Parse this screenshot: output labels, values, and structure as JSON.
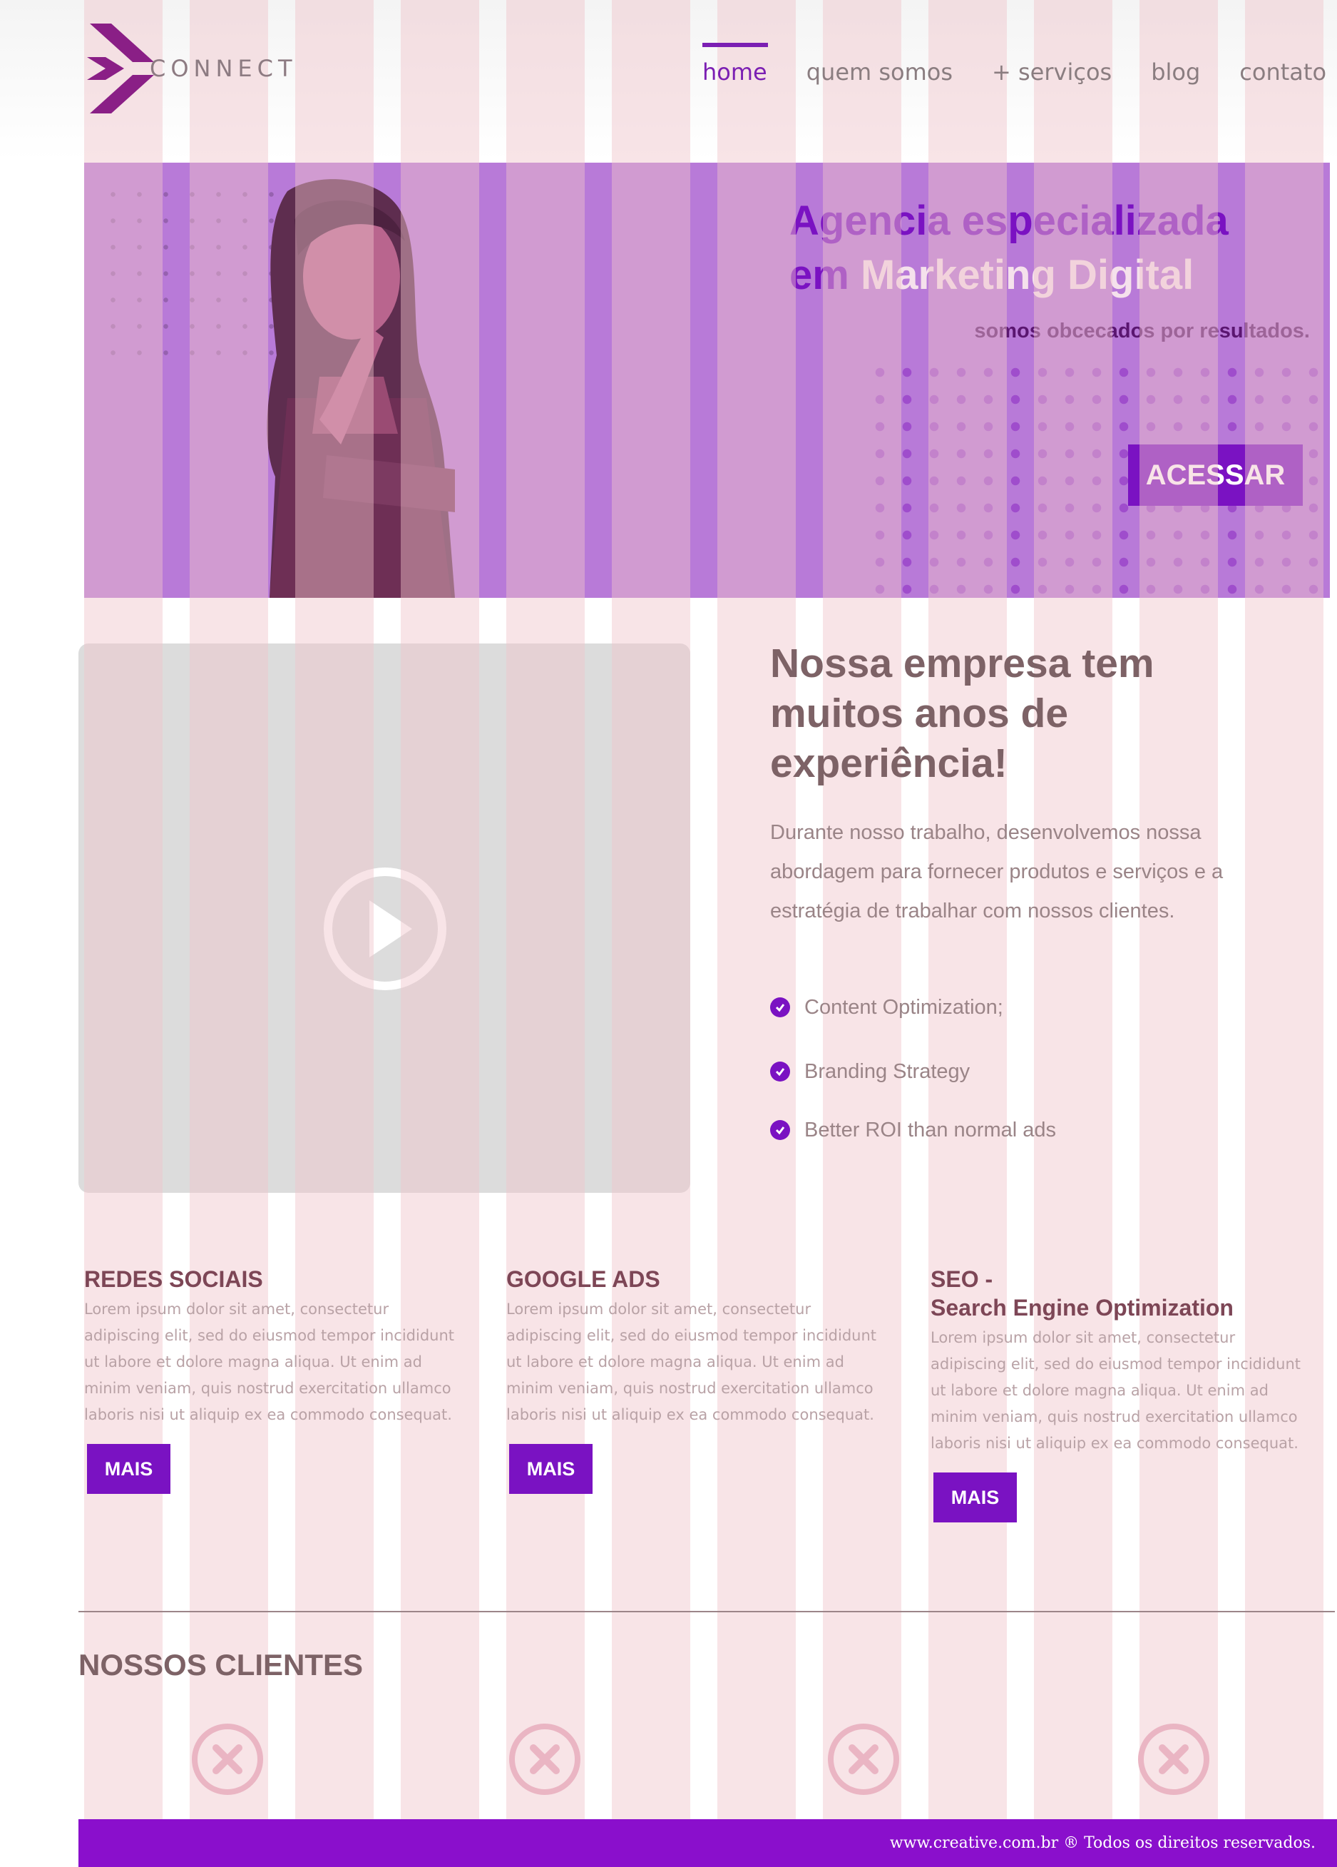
{
  "brand": {
    "name": "CONNECT",
    "accent_color": "#7a12c2"
  },
  "nav": {
    "items": [
      {
        "label": "home",
        "active": true
      },
      {
        "label": "quem somos",
        "active": false
      },
      {
        "label": "+ serviços",
        "active": false
      },
      {
        "label": "blog",
        "active": false
      },
      {
        "label": "contato",
        "active": false
      }
    ]
  },
  "hero": {
    "title_line1": "Agencia especializada",
    "title_line2_prefix": "em ",
    "title_line2_highlight": "Marketing Digital",
    "subtitle": "somos obcecados por resultados.",
    "button_label": "ACESSAR"
  },
  "about": {
    "title": "Nossa empresa tem muitos anos de experiência!",
    "text": "Durante nosso trabalho, desenvolvemos nossa abordagem para fornecer produtos e serviços e a estratégia de trabalhar com nossos clientes.",
    "features": [
      "Content Optimization;",
      "Branding Strategy",
      "Better ROI than normal ads"
    ]
  },
  "services": [
    {
      "title_line1": "REDES SOCIAIS",
      "title_line2": "",
      "text": "Lorem ipsum dolor sit amet, consectetur adipiscing elit, sed do eiusmod tempor incididunt ut labore et dolore magna aliqua. Ut enim ad minim veniam, quis nostrud exercitation ullamco laboris nisi ut aliquip ex ea commodo consequat.",
      "button_label": "MAIS"
    },
    {
      "title_line1": "GOOGLE ADS",
      "title_line2": "",
      "text": "Lorem ipsum dolor sit amet, consectetur adipiscing elit, sed do eiusmod tempor incididunt ut labore et dolore magna aliqua. Ut enim ad minim veniam, quis nostrud exercitation ullamco laboris nisi ut aliquip ex ea commodo consequat.",
      "button_label": "MAIS"
    },
    {
      "title_line1": "SEO -",
      "title_line2": "Search Engine Optimization",
      "text": "Lorem ipsum dolor sit amet, consectetur adipiscing elit, sed do eiusmod tempor incididunt ut labore et dolore magna aliqua. Ut enim ad minim veniam, quis nostrud exercitation ullamco laboris nisi ut aliquip ex ea commodo consequat.",
      "button_label": "MAIS"
    }
  ],
  "clients": {
    "title": "NOSSOS CLIENTES",
    "logos": [
      "placeholder-icon",
      "placeholder-icon",
      "placeholder-icon",
      "placeholder-icon"
    ]
  },
  "footer": {
    "text": "www.creative.com.br ® Todos os direitos reservados."
  }
}
